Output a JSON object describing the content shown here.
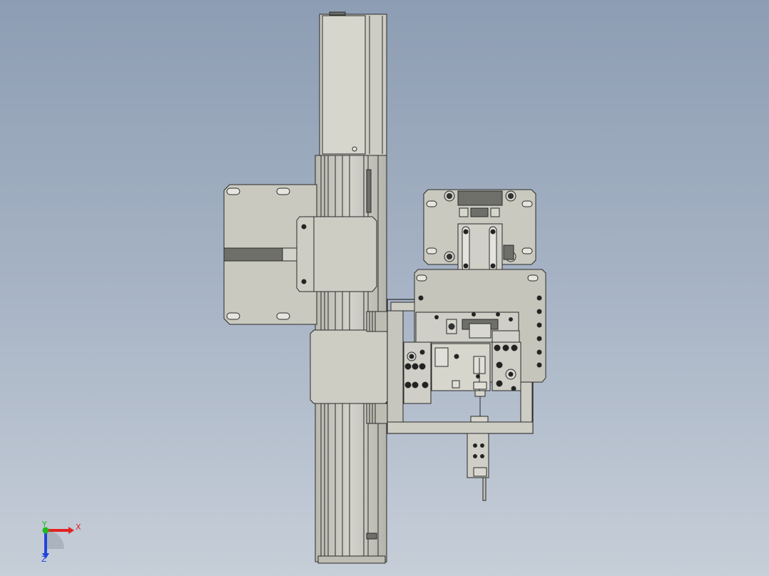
{
  "viewport": {
    "background_top": "#8d9db3",
    "background_bottom": "#c6ced8",
    "part_color": "#c8c8bf",
    "part_shadow": "#a9a9a0",
    "edge_color": "#2a2a2a",
    "dark_plate": "#6f6f6a"
  },
  "triad": {
    "x_label": "X",
    "y_label": "Y",
    "z_label": "Z",
    "x_color": "#e22222",
    "y_color": "#22b822",
    "z_color": "#2244dd"
  }
}
